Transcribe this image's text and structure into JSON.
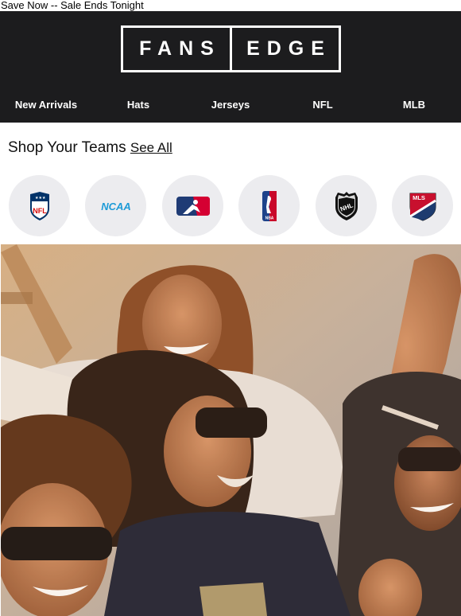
{
  "preheader": "Save Now -- Sale Ends Tonight",
  "brand": {
    "left": "FANS",
    "right": "EDGE"
  },
  "nav": [
    {
      "label": "New Arrivals"
    },
    {
      "label": "Hats"
    },
    {
      "label": "Jerseys"
    },
    {
      "label": "NFL"
    },
    {
      "label": "MLB"
    }
  ],
  "shop": {
    "title": "Shop Your Teams",
    "see_all": "See All"
  },
  "leagues": [
    {
      "name": "nfl-logo",
      "text": "NFL"
    },
    {
      "name": "ncaa-logo",
      "text": "NCAA"
    },
    {
      "name": "mlb-logo",
      "text": ""
    },
    {
      "name": "nba-logo",
      "text": "NBA"
    },
    {
      "name": "nhl-logo",
      "text": "NHL"
    },
    {
      "name": "mls-logo",
      "text": "MLS"
    }
  ],
  "colors": {
    "header_bg": "#1c1c1e",
    "league_bg": "#ececef",
    "nfl_blue": "#013369",
    "nfl_red": "#d50a0a",
    "ncaa_blue": "#1d9bd7"
  }
}
